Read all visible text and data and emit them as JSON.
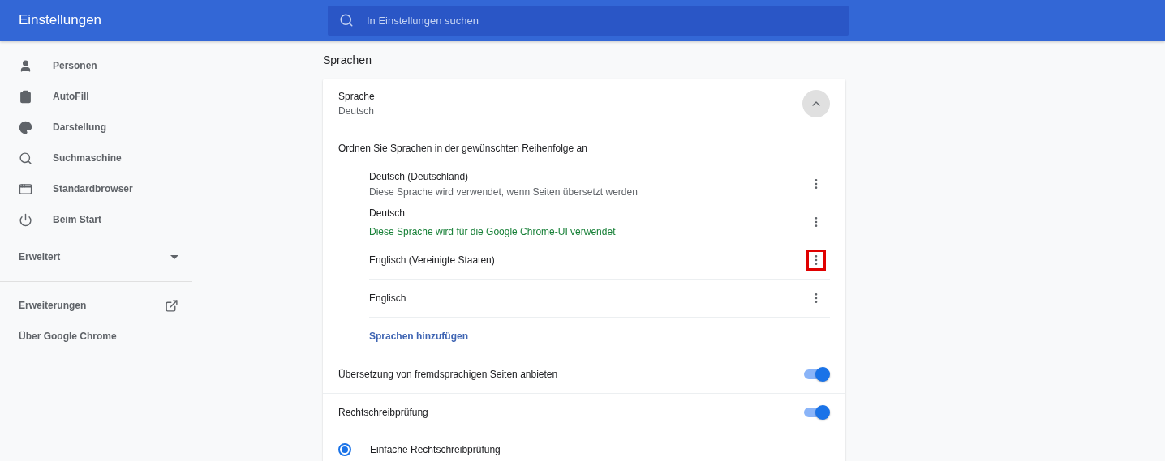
{
  "header": {
    "title": "Einstellungen",
    "search": {
      "placeholder": "In Einstellungen suchen"
    }
  },
  "sidebar": {
    "items": [
      {
        "label": "Personen"
      },
      {
        "label": "AutoFill"
      },
      {
        "label": "Darstellung"
      },
      {
        "label": "Suchmaschine"
      },
      {
        "label": "Standardbrowser"
      },
      {
        "label": "Beim Start"
      }
    ],
    "advanced": {
      "label": "Erweitert",
      "expanded": false
    },
    "links": [
      {
        "label": "Erweiterungen",
        "external": true
      },
      {
        "label": "Über Google Chrome",
        "external": false
      }
    ]
  },
  "section_title": "Sprachen",
  "language": {
    "title": "Sprache",
    "value": "Deutsch",
    "expanded": true,
    "order_hint": "Ordnen Sie Sprachen in der gewünschten Reihenfolge an",
    "languages": [
      {
        "name": "Deutsch (Deutschland)",
        "note": "Diese Sprache wird verwendet, wenn Seiten übersetzt werden",
        "note_emphasized": false,
        "highlighted": false
      },
      {
        "name": "Deutsch",
        "note": "Diese Sprache wird für die Google Chrome-UI verwendet",
        "note_emphasized": true,
        "highlighted": false
      },
      {
        "name": "Englisch (Vereinigte Staaten)",
        "highlighted": true
      },
      {
        "name": "Englisch",
        "highlighted": false
      }
    ],
    "add_link": "Sprachen hinzufügen"
  },
  "settings": [
    {
      "kind": "toggle",
      "label": "Übersetzung von fremdsprachigen Seiten anbieten",
      "on": true
    },
    {
      "kind": "toggle",
      "label": "Rechtschreibprüfung",
      "on": true
    },
    {
      "kind": "radio",
      "label": "Einfache Rechtschreibprüfung",
      "selected": true
    }
  ]
}
